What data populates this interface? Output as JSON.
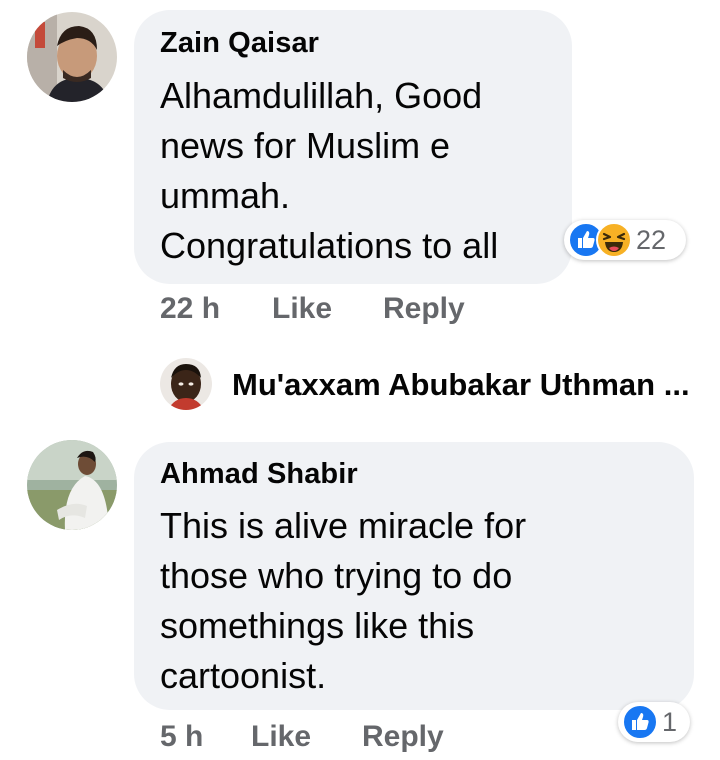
{
  "comments": [
    {
      "author": "Zain Qaisar",
      "text": "Alhamdulillah, Good\nnews for Muslim e\nummah.\nCongratulations to all",
      "time": "22 h",
      "like_label": "Like",
      "reply_label": "Reply",
      "reactions": {
        "icons": [
          "like-reaction",
          "haha-reaction"
        ],
        "count": "22"
      }
    },
    {
      "author": "Ahmad Shabir",
      "text": "This is alive miracle for\nthose who trying to do\nsomethings like this\ncartoonist.",
      "time": "5 h",
      "like_label": "Like",
      "reply_label": "Reply",
      "reactions": {
        "icons": [
          "like-reaction"
        ],
        "count": "1"
      }
    }
  ],
  "reply_preview": {
    "author": "Mu'axxam Abubakar Uthman ..."
  },
  "colors": {
    "bubble": "#f0f2f5",
    "meta_text": "#65676b",
    "like_blue": "#1877f2",
    "haha_yellow": "#f7b125"
  }
}
